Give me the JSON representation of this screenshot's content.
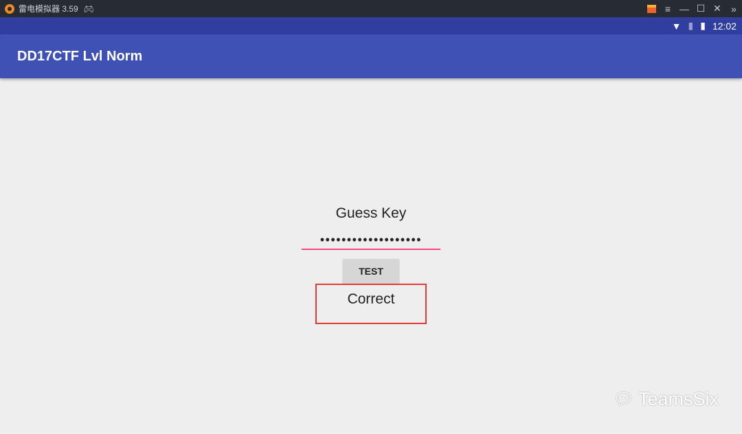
{
  "window": {
    "title": "雷电模拟器 3.59"
  },
  "status": {
    "time": "12:02"
  },
  "app": {
    "title": "DD17CTF Lvl Norm"
  },
  "main": {
    "heading": "Guess Key",
    "password_value": "•••••••••••••••••••",
    "button": "TEST",
    "result": "Correct"
  },
  "watermark": "TeamsSix",
  "colors": {
    "accent": "#ff4081",
    "primary": "#3f51b5",
    "primary_dark": "#303f9f",
    "highlight": "#e53935"
  }
}
